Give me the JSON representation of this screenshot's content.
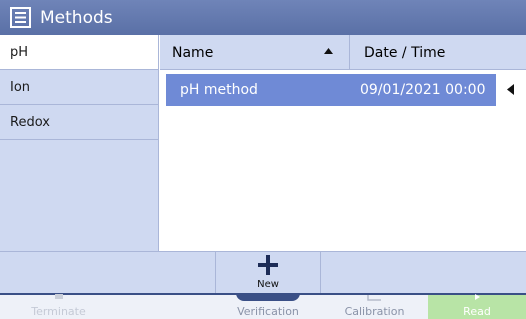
{
  "app": {
    "title": "Methods"
  },
  "sidebar": {
    "items": [
      {
        "label": "pH"
      },
      {
        "label": "Ion"
      },
      {
        "label": "Redox"
      }
    ]
  },
  "table": {
    "headers": {
      "name": "Name",
      "date": "Date / Time"
    },
    "rows": [
      {
        "name": "pH method",
        "date": "09/01/2021 00:00"
      }
    ]
  },
  "toolbar": {
    "new_label": "New"
  },
  "bottom_nav": {
    "items": [
      {
        "label": "Terminate"
      },
      {
        "label": "Verification"
      },
      {
        "label": "Calibration"
      },
      {
        "label": "Read"
      }
    ]
  },
  "colors": {
    "titlebar": "#5f75ab",
    "selected_row": "#6f8ad6",
    "panel": "#cfd9f1",
    "read_button": "#b8e4a6"
  },
  "icons": {
    "title": "methods-icon",
    "sort": "sort-ascending-icon",
    "row_action": "chevron-left-icon",
    "new": "plus-icon"
  }
}
